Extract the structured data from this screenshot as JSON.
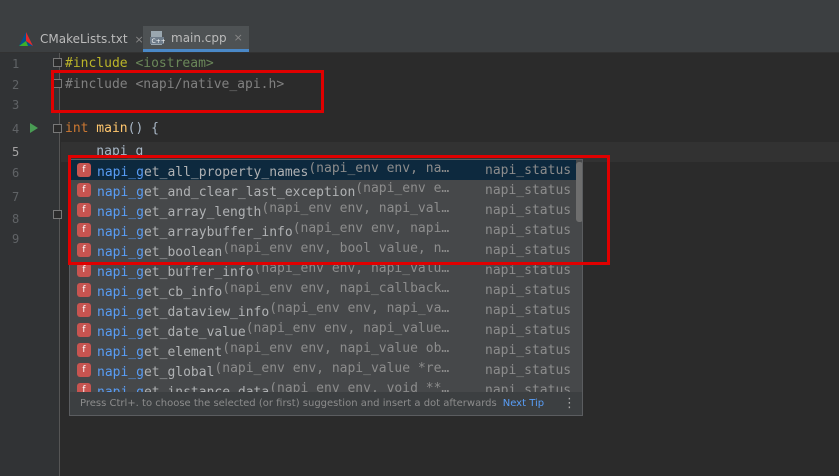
{
  "tabs": [
    {
      "label": "CMakeLists.txt",
      "close": "×",
      "icon": "cmake-icon"
    },
    {
      "label": "main.cpp",
      "close": "×",
      "icon": "cpp-file-icon"
    }
  ],
  "line_numbers": [
    "1",
    "2",
    "3",
    "4",
    "5",
    "6",
    "7",
    "8",
    "9"
  ],
  "code": {
    "line1_directive": "#include",
    "line1_header": " <iostream>",
    "line2": "#include <napi/native_api.h>",
    "line4_kw": "int",
    "line4_fn": " main",
    "line4_rest": "() {",
    "line5": "    napi_g"
  },
  "completion": {
    "items": [
      {
        "match": "napi_g",
        "rest": "et_all_property_names",
        "sig": "(napi_env env, na…",
        "ret": "napi_status"
      },
      {
        "match": "napi_g",
        "rest": "et_and_clear_last_exception",
        "sig": "(napi_env e…",
        "ret": "napi_status"
      },
      {
        "match": "napi_g",
        "rest": "et_array_length",
        "sig": "(napi_env env, napi_val…",
        "ret": "napi_status"
      },
      {
        "match": "napi_g",
        "rest": "et_arraybuffer_info",
        "sig": "(napi_env env, napi…",
        "ret": "napi_status"
      },
      {
        "match": "napi_g",
        "rest": "et_boolean",
        "sig": "(napi_env env, bool value, n…",
        "ret": "napi_status"
      },
      {
        "match": "napi_g",
        "rest": "et_buffer_info",
        "sig": "(napi_env env, napi_valu…",
        "ret": "napi_status"
      },
      {
        "match": "napi_g",
        "rest": "et_cb_info",
        "sig": "(napi_env env, napi_callback…",
        "ret": "napi_status"
      },
      {
        "match": "napi_g",
        "rest": "et_dataview_info",
        "sig": "(napi_env env, napi_va…",
        "ret": "napi_status"
      },
      {
        "match": "napi_g",
        "rest": "et_date_value",
        "sig": "(napi_env env, napi_value…",
        "ret": "napi_status"
      },
      {
        "match": "napi_g",
        "rest": "et_element",
        "sig": "(napi_env env, napi_value ob…",
        "ret": "napi_status"
      },
      {
        "match": "napi_g",
        "rest": "et_global",
        "sig": "(napi_env env, napi_value *re…",
        "ret": "napi_status"
      },
      {
        "match": "napi_g",
        "rest": "et_instance_data",
        "sig": "(napi_env env, void **…",
        "ret": "napi_status"
      }
    ],
    "badge": "f",
    "footer_hint": "Press Ctrl+. to choose the selected (or first) suggestion and insert a dot afterwards",
    "footer_link": "Next Tip",
    "footer_menu": "⋮"
  },
  "colors": {
    "highlight_box": "#e00000",
    "match": "#589df6",
    "method_badge": "#c75450"
  }
}
